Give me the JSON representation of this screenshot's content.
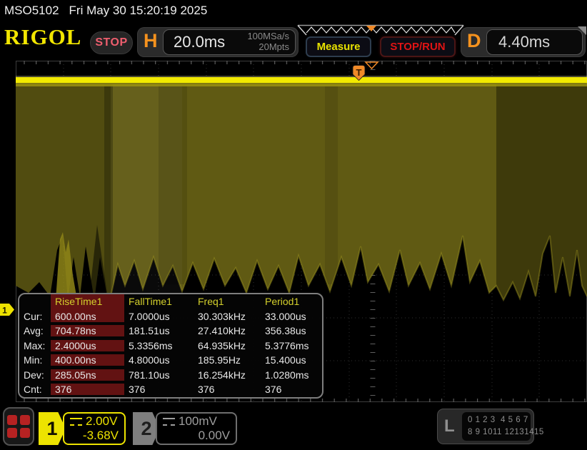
{
  "status_bar": {
    "model": "MSO5102",
    "datetime": "Fri May 30 15:20:19 2025"
  },
  "header": {
    "logo": "RIGOL",
    "run_state": "STOP",
    "horizontal": {
      "label": "H",
      "timebase": "20.0ms",
      "sample_rate": "100MSa/s",
      "memory_depth": "20Mpts"
    },
    "measure_label": "Measure",
    "stop_run_label": "STOP/RUN",
    "delay": {
      "label": "D",
      "value": "4.40ms"
    }
  },
  "trigger": {
    "symbol": "T"
  },
  "measurements": {
    "columns": [
      "RiseTime1",
      "FallTime1",
      "Freq1",
      "Period1"
    ],
    "highlighted_column": "RiseTime1",
    "rows": [
      {
        "label": "Cur:",
        "values": [
          "600.00ns",
          "7.0000us",
          "30.303kHz",
          "33.000us"
        ]
      },
      {
        "label": "Avg:",
        "values": [
          "704.78ns",
          "181.51us",
          "27.410kHz",
          "356.38us"
        ]
      },
      {
        "label": "Max:",
        "values": [
          "2.4000us",
          "5.3356ms",
          "64.935kHz",
          "5.3776ms"
        ]
      },
      {
        "label": "Min:",
        "values": [
          "400.00ns",
          "4.8000us",
          "185.95Hz",
          "15.400us"
        ]
      },
      {
        "label": "Dev:",
        "values": [
          "285.05ns",
          "781.10us",
          "16.254kHz",
          "1.0280ms"
        ]
      },
      {
        "label": "Cnt:",
        "values": [
          "376",
          "376",
          "376",
          "376"
        ]
      }
    ]
  },
  "channels": [
    {
      "id": "1",
      "scale": "2.00V",
      "offset": "-3.68V",
      "color": "#ede300",
      "active": true
    },
    {
      "id": "2",
      "scale": "100mV",
      "offset": "0.00V",
      "color": "#9e9e9e",
      "active": false
    }
  ],
  "logic": {
    "label": "L",
    "row1": "0 1 2 3  4 5 6 7",
    "row2": "8 9 1011 12131415"
  },
  "colors": {
    "accent_orange": "#f08a28",
    "stop_badge_red": "#ee5e6e",
    "stop_run_red": "#e01414",
    "measure_yellow": "#e8e300",
    "channel1_yellow": "#ede300",
    "table_highlight": "#621212",
    "trace_yellow": "#f2ea00"
  }
}
